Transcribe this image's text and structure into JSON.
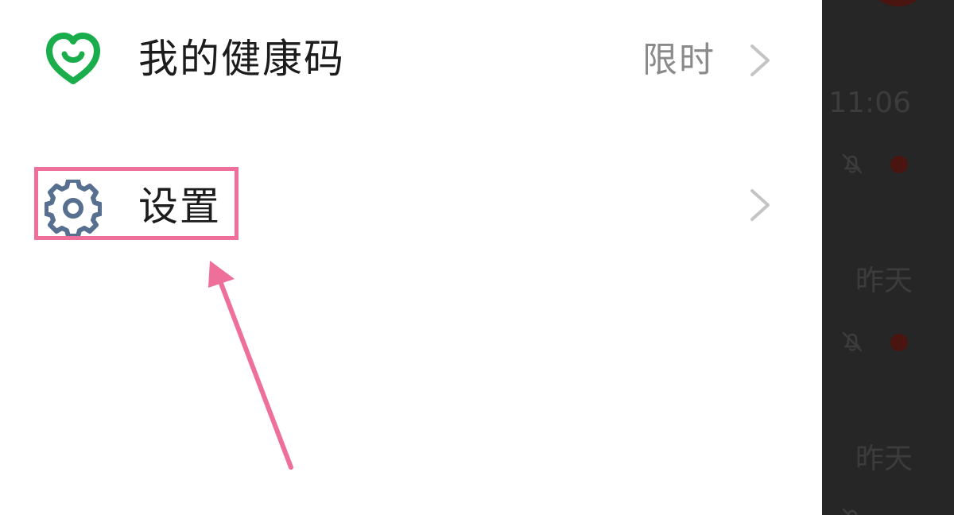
{
  "drawer": {
    "items": [
      {
        "label": "我的健康码",
        "tag": "限时",
        "icon": "health-code-heart-icon",
        "icon_color": "#1aad4b"
      },
      {
        "label": "设置",
        "icon": "gear-icon",
        "icon_color": "#58708f"
      }
    ]
  },
  "annotation": {
    "highlight_color": "#ef6f9b",
    "target": "settings"
  },
  "background_chat": {
    "times": [
      "11:06",
      "昨天",
      "昨天"
    ],
    "mute_icon": "bell-off-icon",
    "unread_dot_color": "#4a1410"
  }
}
